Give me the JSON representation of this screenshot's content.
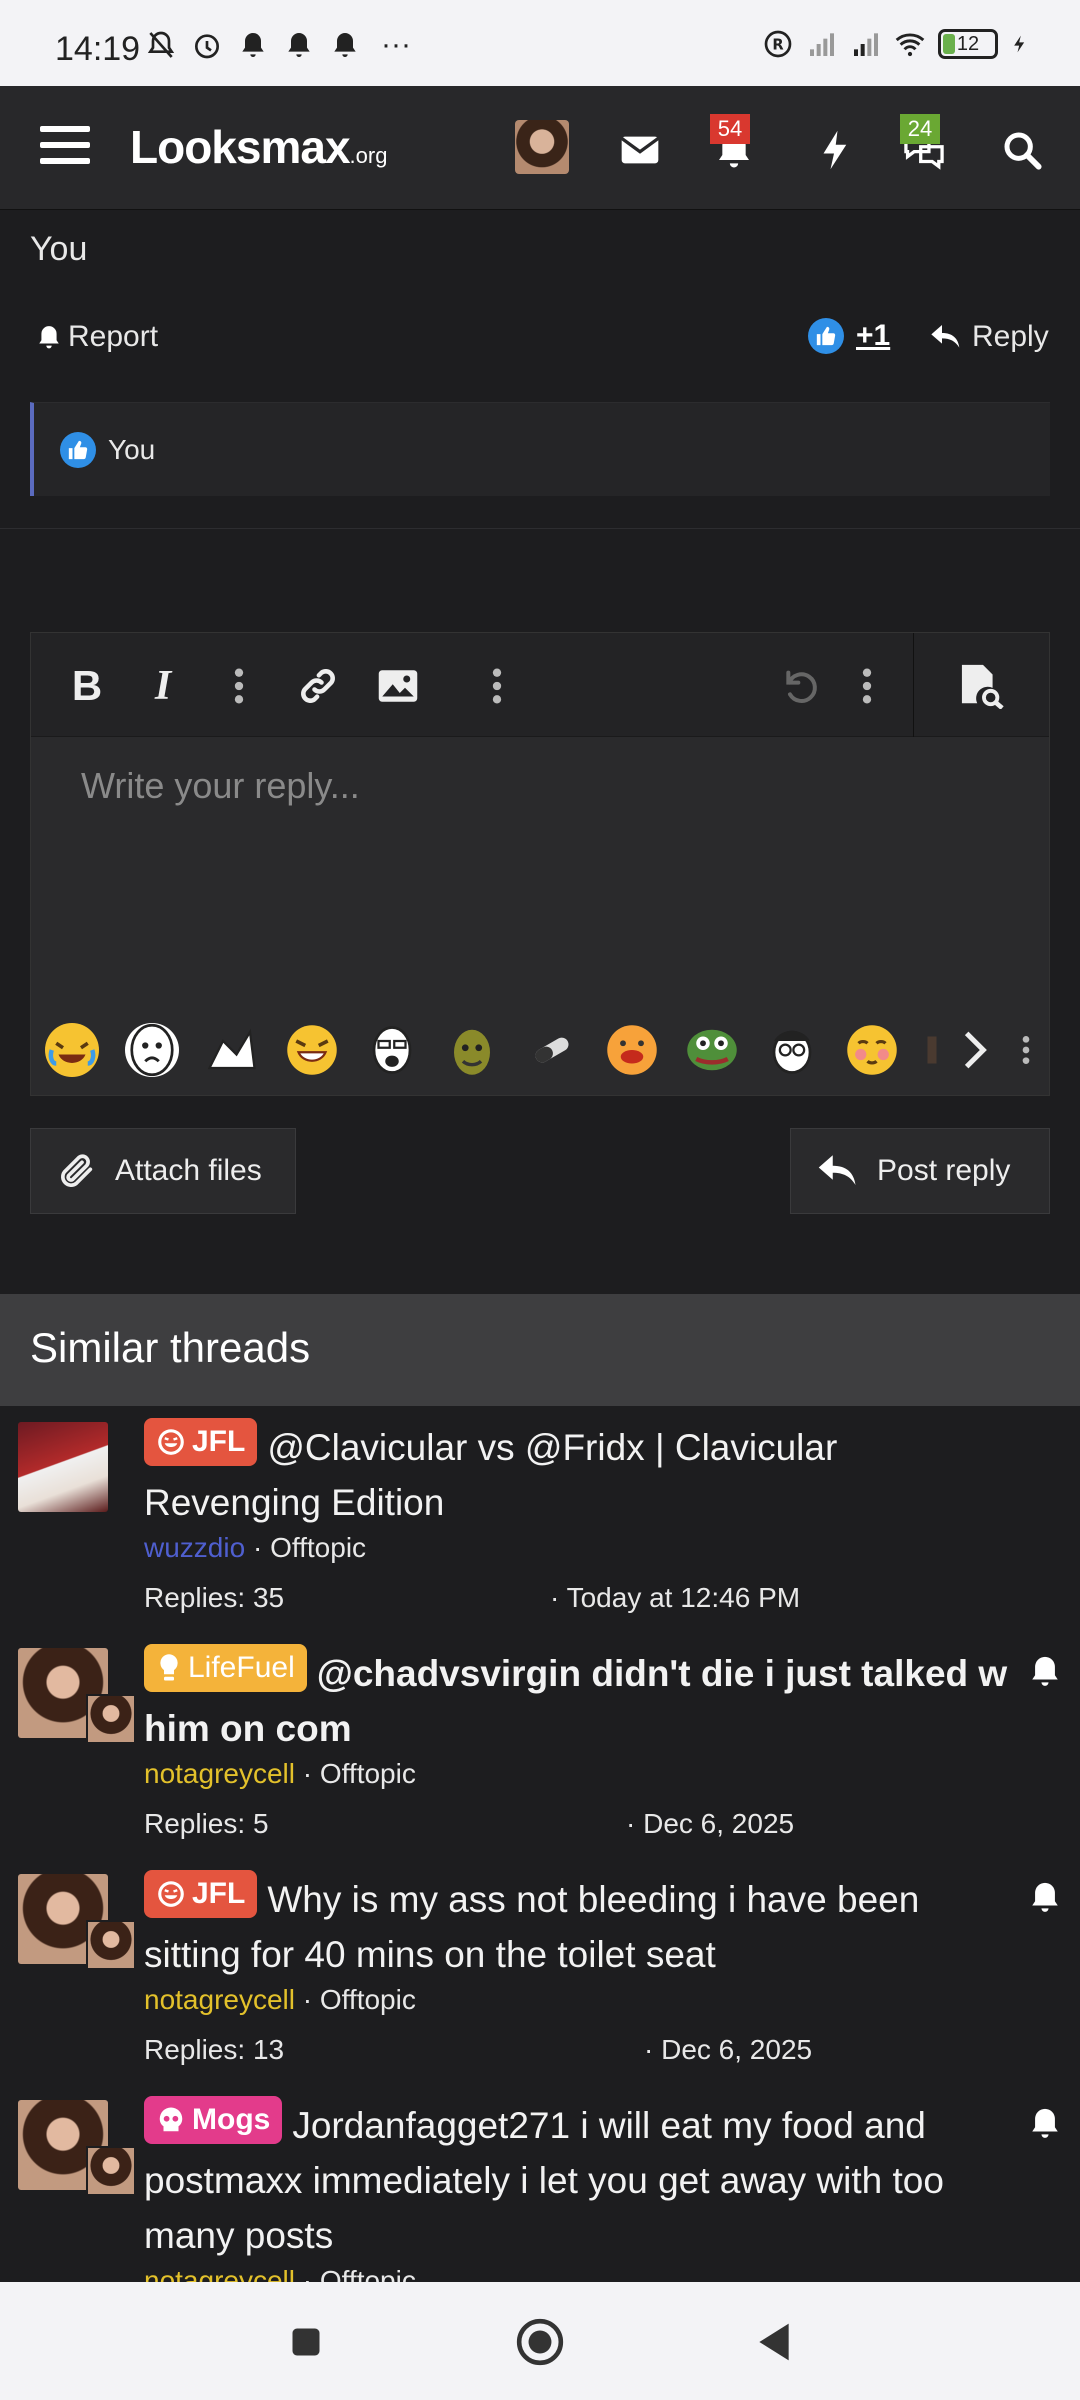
{
  "status_bar": {
    "time": "14:19",
    "battery": "12",
    "overflow": "···"
  },
  "header": {
    "logo": "Looksmax",
    "logo_suffix": ".org",
    "alerts_count": "54",
    "conversations_count": "24"
  },
  "post": {
    "author_line": "You",
    "report_label": "Report",
    "reaction_count": "+1",
    "reply_label": "Reply",
    "reaction_by": "You"
  },
  "editor": {
    "placeholder": "Write your reply...",
    "bold": "B",
    "italic": "I"
  },
  "buttons": {
    "attach_files": "Attach files",
    "post_reply": "Post reply"
  },
  "similar_threads": {
    "heading": "Similar threads",
    "items": [
      {
        "prefix": "JFL",
        "title": "@Clavicular vs @Fridx | Clavicular Revenging Edition",
        "author": "wuzzdio",
        "forum": "Offtopic",
        "replies": "Replies: 35",
        "date": "· Today at 12:46 PM"
      },
      {
        "prefix": "LifeFuel",
        "title": "@chadvsvirgin didn't die i just talked w him on com",
        "author": "notagreycell",
        "forum": "Offtopic",
        "replies": "Replies: 5",
        "date": "· Dec 6, 2025"
      },
      {
        "prefix": "JFL",
        "title": "Why is my ass not bleeding i have been sitting for 40 mins on the toilet seat",
        "author": "notagreycell",
        "forum": "Offtopic",
        "replies": "Replies: 13",
        "date": "· Dec 6, 2025"
      },
      {
        "prefix": "Mogs",
        "title": "Jordanfagget271 i will eat my food and postmaxx immediately i let you get away with too many posts",
        "author": "notagreycell",
        "forum": "Offtopic"
      }
    ]
  },
  "colors": {
    "background": "#1d1d1f",
    "header_bg": "#28282a",
    "alert_badge": "#d9382f",
    "conversation_badge": "#6aa833",
    "prefix_jfl": "#e4553f",
    "prefix_lifefuel": "#f4b33a",
    "prefix_mogs": "#e33b8b",
    "like_blue": "#2f8fe6"
  },
  "icons": [
    "hamburger-icon",
    "envelope-icon",
    "bell-icon",
    "bolt-icon",
    "chat-bubbles-icon",
    "search-icon",
    "thumbs-up-icon",
    "reply-arrow-icon",
    "paperclip-icon",
    "undo-icon",
    "preview-icon"
  ]
}
